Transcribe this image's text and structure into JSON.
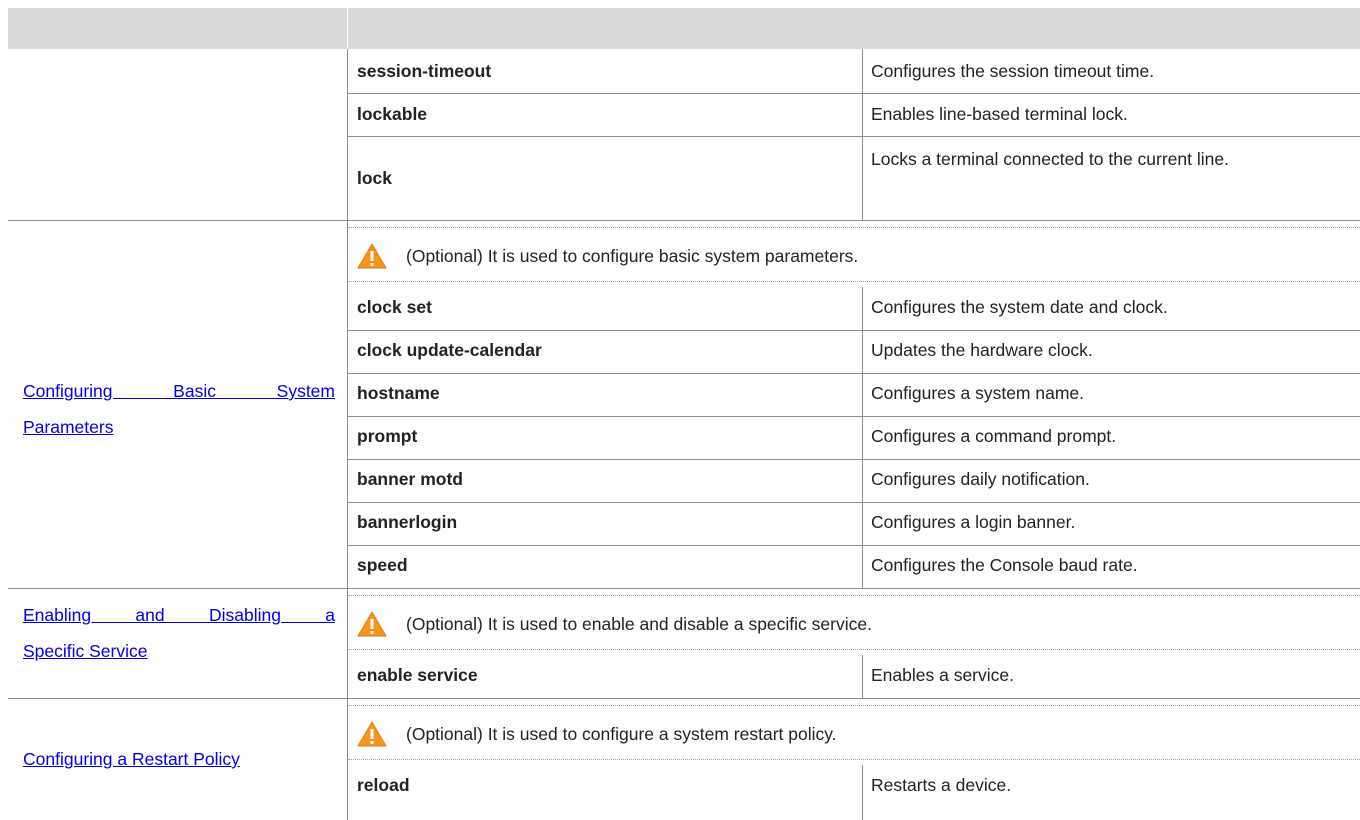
{
  "table": {
    "header": {
      "col1": "",
      "col2": ""
    },
    "top_rows": [
      {
        "command": "session-timeout",
        "description": "Configures the session timeout time."
      },
      {
        "command": "lockable",
        "description": "Enables line-based terminal lock."
      },
      {
        "command": "lock",
        "description": "Locks a terminal connected to the current line."
      }
    ],
    "sections": [
      {
        "task_line1": "Configuring Basic System",
        "task_line2": "Parameters",
        "note": "(Optional) It is used to configure basic system parameters.",
        "rows": [
          {
            "command": "clock set",
            "description": "Configures the system date and clock."
          },
          {
            "command": "clock update-calendar",
            "description": "Updates the hardware clock."
          },
          {
            "command": "hostname",
            "description": "Configures a system name."
          },
          {
            "command": "prompt",
            "description": "Configures a command prompt."
          },
          {
            "command": "banner motd",
            "description": "Configures daily notification."
          },
          {
            "command": "bannerlogin",
            "description": "Configures a login banner."
          },
          {
            "command": "speed",
            "description": "Configures the Console baud rate."
          }
        ]
      },
      {
        "task_line1": "Enabling and Disabling a",
        "task_line2": "Specific Service",
        "note": "(Optional) It is used to enable and disable a specific service.",
        "rows": [
          {
            "command": "enable service",
            "description": "Enables a service."
          }
        ]
      },
      {
        "task_line1": "Configuring a Restart Policy",
        "task_line2": "",
        "note": "(Optional) It is used to configure a system restart policy.",
        "rows": [
          {
            "command": "reload",
            "description": "Restarts a device."
          }
        ]
      }
    ]
  },
  "icons": {
    "warning": "warning-triangle-icon"
  },
  "colors": {
    "header_bg": "#d9d9d9",
    "link": "#0000ee",
    "warning_fill": "#f7941d",
    "border": "#8c8c8c"
  }
}
